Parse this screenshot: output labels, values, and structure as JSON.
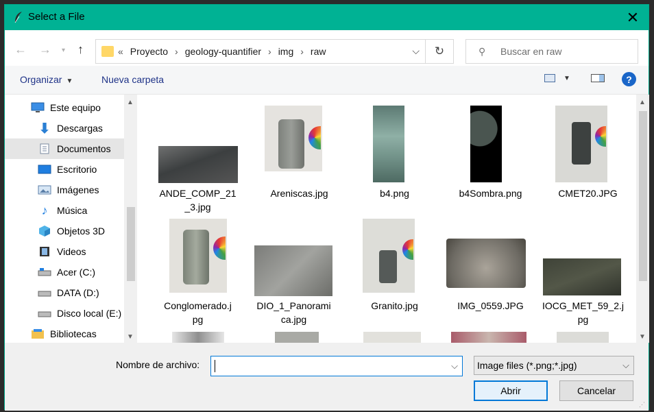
{
  "window": {
    "title": "Select a File"
  },
  "nav": {
    "breadcrumb": [
      "Proyecto",
      "geology-quantifier",
      "img",
      "raw"
    ],
    "overflow": "«",
    "search_placeholder": "Buscar en raw"
  },
  "toolbar": {
    "organize": "Organizar",
    "new_folder": "Nueva carpeta"
  },
  "sidebar": {
    "items": [
      {
        "label": "Este equipo",
        "icon": "computer-icon"
      },
      {
        "label": "Descargas",
        "icon": "download-icon"
      },
      {
        "label": "Documentos",
        "icon": "document-icon",
        "selected": true
      },
      {
        "label": "Escritorio",
        "icon": "desktop-icon"
      },
      {
        "label": "Imágenes",
        "icon": "pictures-icon"
      },
      {
        "label": "Música",
        "icon": "music-icon"
      },
      {
        "label": "Objetos 3D",
        "icon": "cube-icon"
      },
      {
        "label": "Videos",
        "icon": "video-icon"
      },
      {
        "label": "Acer (C:)",
        "icon": "drive-icon"
      },
      {
        "label": "DATA (D:)",
        "icon": "drive-icon"
      },
      {
        "label": "Disco local (E:)",
        "icon": "drive-icon"
      },
      {
        "label": "Bibliotecas",
        "icon": "library-icon"
      }
    ]
  },
  "files": [
    {
      "name": "ANDE_COMP_21\n_3.jpg"
    },
    {
      "name": "Areniscas.jpg"
    },
    {
      "name": "b4.png"
    },
    {
      "name": "b4Sombra.png"
    },
    {
      "name": "CMET20.JPG"
    },
    {
      "name": "Conglomerado.j\npg"
    },
    {
      "name": "DIO_1_Panorami\nca.jpg"
    },
    {
      "name": "Granito.jpg"
    },
    {
      "name": "IMG_0559.JPG"
    },
    {
      "name": "IOCG_MET_59_2.j\npg"
    }
  ],
  "bottom": {
    "filename_label": "Nombre de archivo:",
    "filename_value": "",
    "filter": "Image files (*.png;*.jpg)",
    "open": "Abrir",
    "cancel": "Cancelar"
  }
}
